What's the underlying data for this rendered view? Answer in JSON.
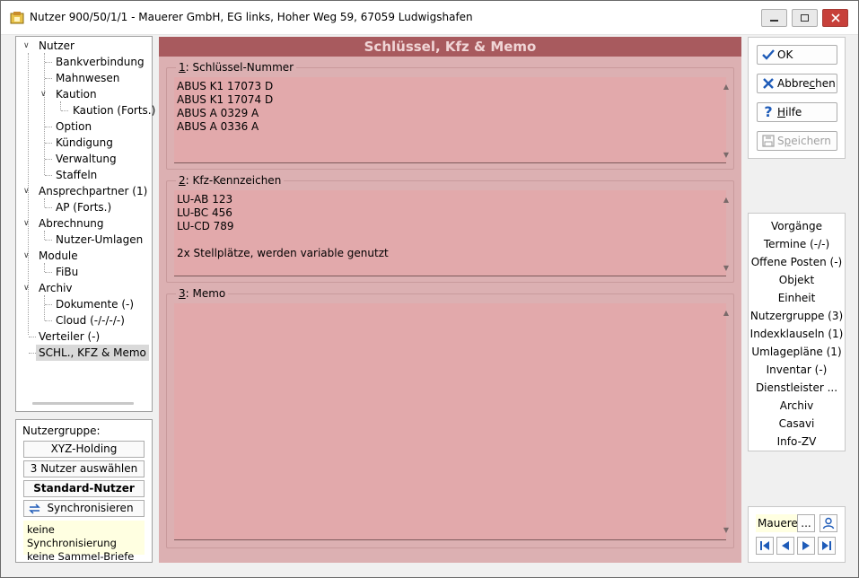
{
  "window": {
    "title": "Nutzer 900/50/1/1 - Mauerer GmbH, EG links, Hoher Weg 59, 67059 Ludwigshafen"
  },
  "tree": {
    "items": [
      {
        "label": "Nutzer",
        "level": 0,
        "expanded": true
      },
      {
        "label": "Bankverbindung",
        "level": 1
      },
      {
        "label": "Mahnwesen",
        "level": 1
      },
      {
        "label": "Kaution",
        "level": 1,
        "expanded": true
      },
      {
        "label": "Kaution (Forts.)",
        "level": 2
      },
      {
        "label": "Option",
        "level": 1
      },
      {
        "label": "Kündigung",
        "level": 1
      },
      {
        "label": "Verwaltung",
        "level": 1
      },
      {
        "label": "Staffeln",
        "level": 1
      },
      {
        "label": "Ansprechpartner (1)",
        "level": 0,
        "expanded": true
      },
      {
        "label": "AP (Forts.)",
        "level": 1
      },
      {
        "label": "Abrechnung",
        "level": 0,
        "expanded": true
      },
      {
        "label": "Nutzer-Umlagen",
        "level": 1
      },
      {
        "label": "Module",
        "level": 0,
        "expanded": true
      },
      {
        "label": "FiBu",
        "level": 1
      },
      {
        "label": "Archiv",
        "level": 0,
        "expanded": true
      },
      {
        "label": "Dokumente (-)",
        "level": 1
      },
      {
        "label": "Cloud (-/-/-/-)",
        "level": 1
      },
      {
        "label": "Verteiler (-)",
        "level": 0
      },
      {
        "label": "SCHL., KFZ & Memo",
        "level": 0,
        "selected": true
      }
    ]
  },
  "group_panel": {
    "title": "Nutzergruppe:",
    "group_button": "XYZ-Holding",
    "select_button": "3 Nutzer auswählen",
    "standard_button": "Standard-Nutzer",
    "sync_button": "Synchronisieren",
    "note_line1": "keine Synchronisierung",
    "note_line2": "keine Sammel-Briefe"
  },
  "main": {
    "header": "Schlüssel, Kfz & Memo",
    "fields": [
      {
        "hotkey": "1",
        "label": ": Schlüssel-Nummer",
        "value": "ABUS K1 17073 D\nABUS K1 17074 D\nABUS A 0329 A\nABUS A 0336 A"
      },
      {
        "hotkey": "2",
        "label": ": Kfz-Kennzeichen",
        "value": "LU-AB 123\nLU-BC 456\nLU-CD 789\n\n2x Stellplätze, werden variable genutzt"
      },
      {
        "hotkey": "3",
        "label": ": Memo",
        "value": ""
      }
    ]
  },
  "actions": {
    "ok": "OK",
    "cancel_pre": "Abbre",
    "cancel_hot": "c",
    "cancel_post": "hen",
    "help_hot": "H",
    "help_post": "ilfe",
    "save_pre": "S",
    "save_hot": "p",
    "save_post": "eichern"
  },
  "nav_links": [
    "Vorgänge",
    "Termine (-/-)",
    "Offene Posten (-)",
    "Objekt",
    "Einheit",
    "Nutzergruppe (3)",
    "Indexklauseln (1)",
    "Umlagepläne (1)",
    "Inventar (-)",
    "Dienstleister ...",
    "Archiv",
    "Casavi",
    "Info-ZV"
  ],
  "nav_footer": {
    "name_value": "Mauere",
    "more_label": "..."
  },
  "colors": {
    "header_bg": "#a85a5e",
    "panel_bg": "#dcb0b2",
    "field_bg": "#e2a9ab",
    "accent_blue": "#1e5bb8"
  }
}
